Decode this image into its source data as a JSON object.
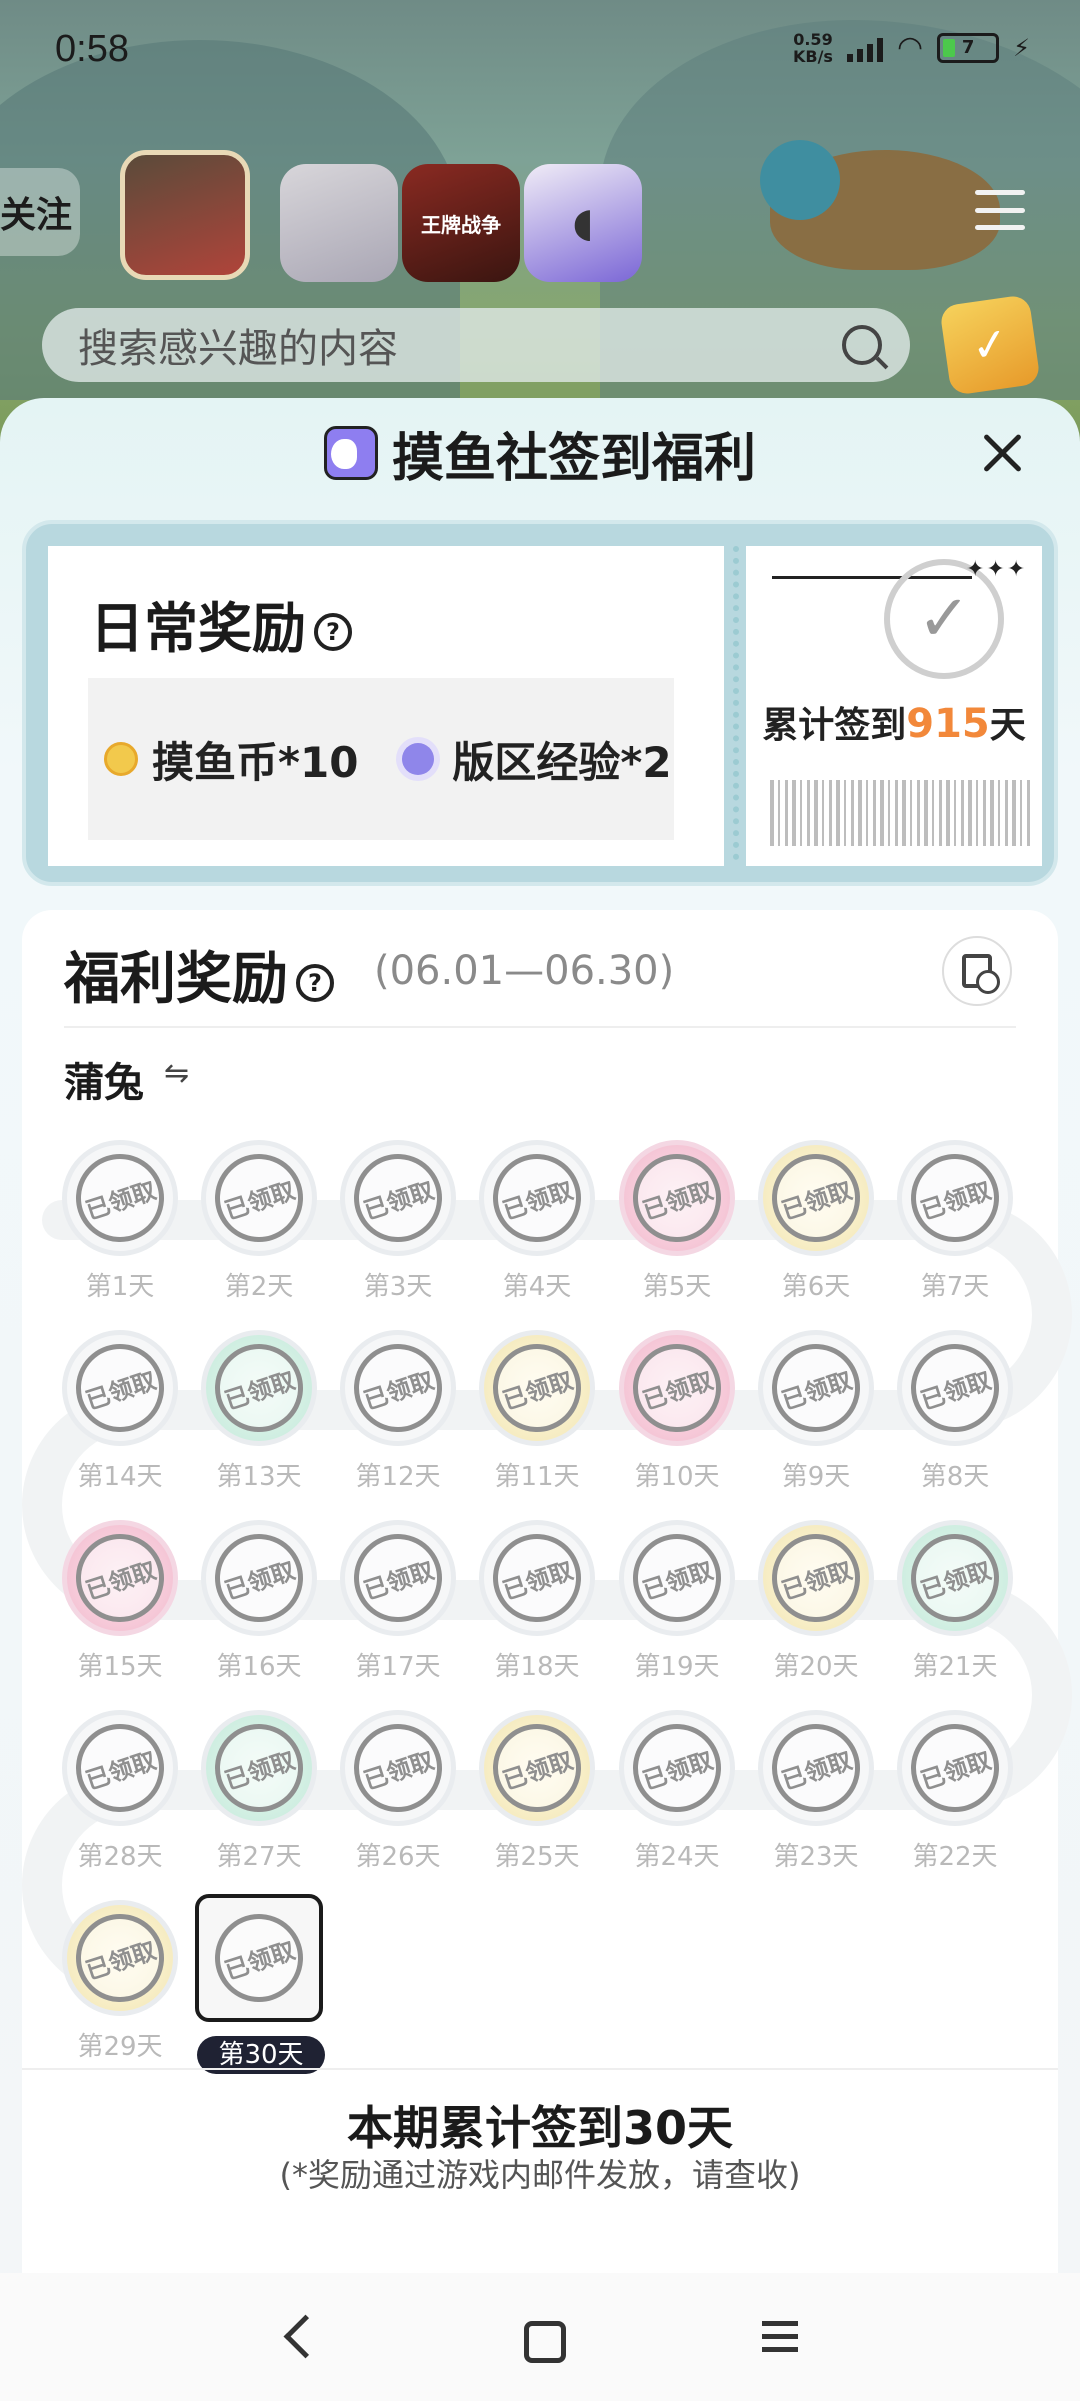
{
  "status_bar": {
    "time": "0:58",
    "net_speed_value": "0.59",
    "net_speed_unit": "KB/s",
    "battery": "7"
  },
  "top_nav": {
    "follow_label": "关注",
    "games": [
      {
        "name": "game-icon-1"
      },
      {
        "name": "game-icon-2"
      },
      {
        "name": "game-icon-3",
        "text": "王牌战争"
      },
      {
        "name": "game-icon-4"
      }
    ]
  },
  "search": {
    "placeholder": "搜索感兴趣的内容"
  },
  "sheet": {
    "title": "摸鱼社签到福利",
    "daily": {
      "title": "日常奖励",
      "help": "?",
      "rewards": [
        {
          "label": "摸鱼币*10",
          "icon": "coin-icon"
        },
        {
          "label": "版区经验*2",
          "icon": "exp-icon"
        }
      ],
      "stars": "✦✦✦",
      "total_prefix": "累计签到",
      "total_days": "915",
      "total_suffix": "天"
    },
    "welfare": {
      "title": "福利奖励",
      "help": "?",
      "period": "(06.01—06.30)",
      "game": "蒲兔",
      "switch": "⇋",
      "claimed_label": "已领取",
      "days": [
        {
          "label": "第1天"
        },
        {
          "label": "第2天"
        },
        {
          "label": "第3天"
        },
        {
          "label": "第4天"
        },
        {
          "label": "第5天"
        },
        {
          "label": "第6天"
        },
        {
          "label": "第7天"
        },
        {
          "label": "第14天"
        },
        {
          "label": "第13天"
        },
        {
          "label": "第12天"
        },
        {
          "label": "第11天"
        },
        {
          "label": "第10天"
        },
        {
          "label": "第9天"
        },
        {
          "label": "第8天"
        },
        {
          "label": "第15天"
        },
        {
          "label": "第16天"
        },
        {
          "label": "第17天"
        },
        {
          "label": "第18天"
        },
        {
          "label": "第19天"
        },
        {
          "label": "第20天"
        },
        {
          "label": "第21天"
        },
        {
          "label": "第28天"
        },
        {
          "label": "第27天"
        },
        {
          "label": "第26天"
        },
        {
          "label": "第25天"
        },
        {
          "label": "第24天"
        },
        {
          "label": "第23天"
        },
        {
          "label": "第22天"
        },
        {
          "label": "第29天"
        },
        {
          "label": "第30天"
        }
      ],
      "summary_title": "本期累计签到30天",
      "summary_note": "(*奖励通过游戏内邮件发放，请查收)"
    }
  },
  "colors": {
    "accent_orange": "#f2883a",
    "ticket_border": "#b8d8df",
    "current_day_badge": "#1f2233"
  }
}
